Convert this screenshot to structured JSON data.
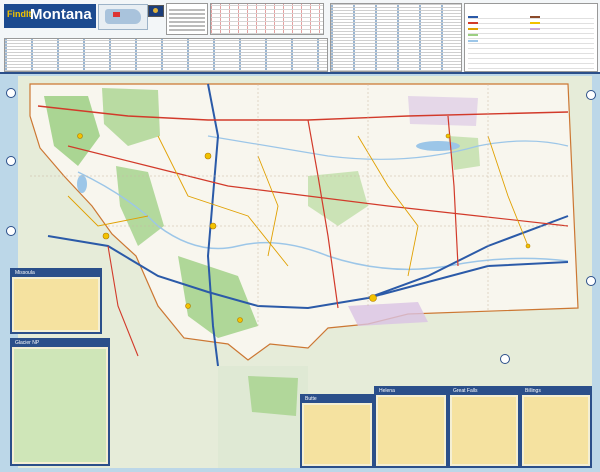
{
  "header": {
    "brand_findit": "FindIt",
    "brand_state": "Montana"
  },
  "insets": {
    "missoula": "Missoula",
    "glacier": "Glacier NP",
    "butte": "Butte",
    "helena": "Helena",
    "great_falls": "Great Falls",
    "billings": "Billings"
  },
  "colors": {
    "header_blue": "#1c4a8f",
    "accent_yellow": "#f2c200",
    "land": "#dfe9d4",
    "forest": "#9ccf82",
    "interstate": "#2b5aa8",
    "us_highway": "#d23a2a",
    "state_road": "#e0a000",
    "water": "#9cc6e8"
  },
  "icons": [
    "compass-rose-icon",
    "city-dot-icon",
    "flag-icon"
  ]
}
